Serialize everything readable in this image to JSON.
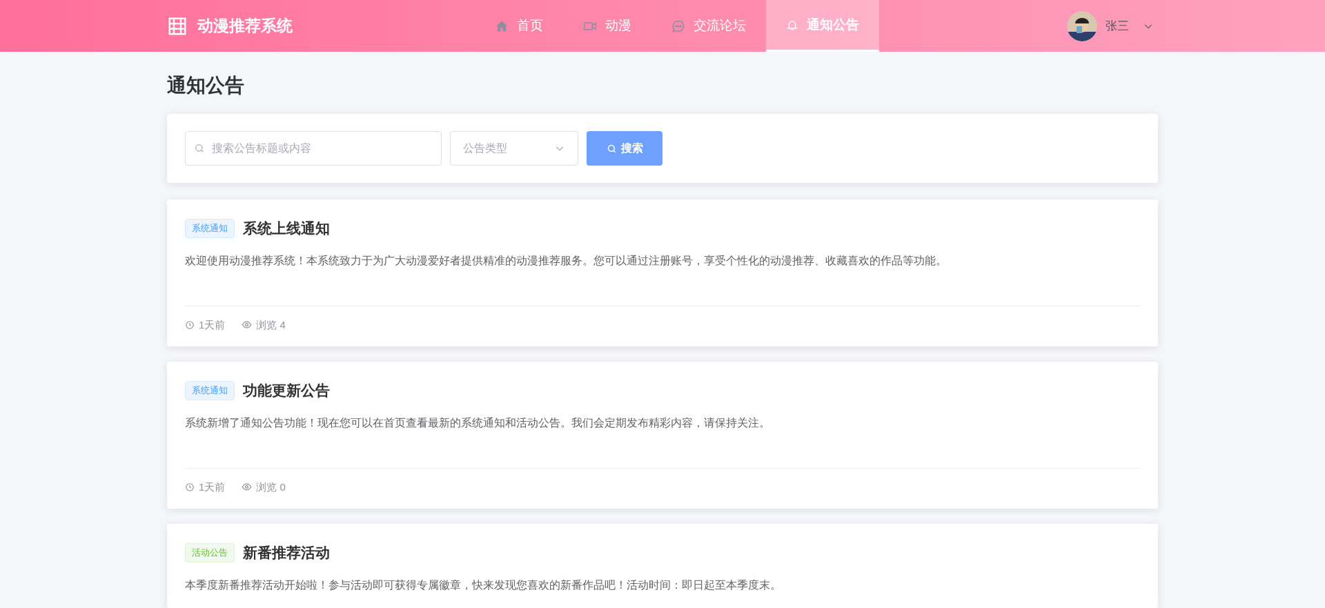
{
  "header": {
    "brand": "动漫推荐系统",
    "nav": [
      {
        "kind": "home",
        "label": "首页",
        "selected": false
      },
      {
        "kind": "video",
        "label": "动漫",
        "selected": false
      },
      {
        "kind": "chat",
        "label": "交流论坛",
        "selected": false
      },
      {
        "kind": "bell",
        "label": "通知公告",
        "selected": true
      }
    ],
    "user": {
      "name": "张三"
    }
  },
  "page_title": "通知公告",
  "filters": {
    "search": {
      "placeholder": "搜索公告标题或内容"
    },
    "type_select": {
      "placeholder": "公告类型"
    },
    "search_button": "搜索"
  },
  "notices": [
    {
      "tag": "系统通知",
      "kind": "system",
      "title": "系统上线通知",
      "body": "欢迎使用动漫推荐系统！本系统致力于为广大动漫爱好者提供精准的动漫推荐服务。您可以通过注册账号，享受个性化的动漫推荐、收藏喜欢的作品等功能。",
      "time": "1天前",
      "views": "浏览 4"
    },
    {
      "tag": "系统通知",
      "kind": "system",
      "title": "功能更新公告",
      "body": "系统新增了通知公告功能！现在您可以在首页查看最新的系统通知和活动公告。我们会定期发布精彩内容，请保持关注。",
      "time": "1天前",
      "views": "浏览 0"
    },
    {
      "tag": "活动公告",
      "kind": "activity",
      "title": "新番推荐活动",
      "body": "本季度新番推荐活动开始啦！参与活动即可获得专属徽章，快来发现您喜欢的新番作品吧！活动时间：即日起至本季度末。"
    }
  ]
}
